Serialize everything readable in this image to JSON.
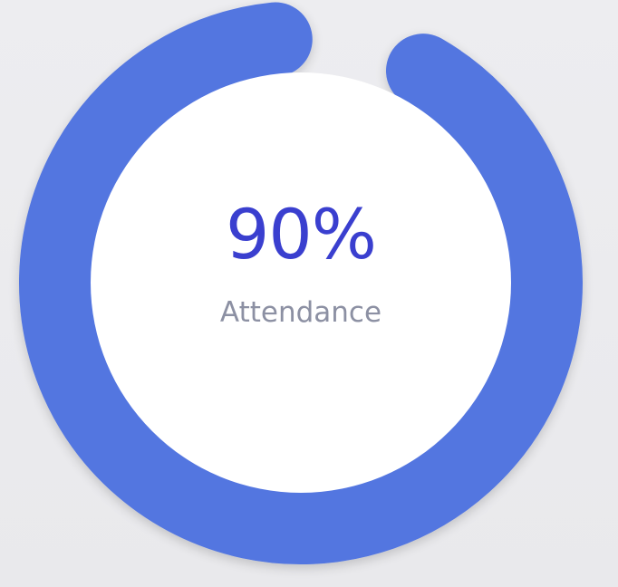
{
  "chart_data": {
    "type": "radial-progress",
    "value": 90,
    "max": 100,
    "value_label": "90%",
    "caption": "Attendance"
  },
  "colors": {
    "track_fill": "#5276e0",
    "center_fill": "#ffffff",
    "value_text": "#3a3fcf",
    "caption_text": "#8c90a3",
    "background": "#ececef"
  }
}
